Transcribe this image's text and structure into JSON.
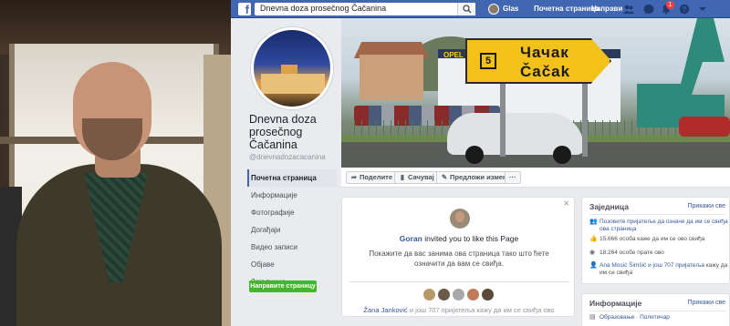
{
  "search": {
    "value": "Dnevna doza prosečnog Čačanina"
  },
  "topbar": {
    "user": "Glas",
    "home": "Почетна страница",
    "create": "Направи",
    "notifications_count": "1"
  },
  "page": {
    "name": "Dnevna doza prosečnog Čačanina",
    "handle": "@dnevnadozacacanina"
  },
  "nav": [
    {
      "label": "Почетна страница"
    },
    {
      "label": "Информације"
    },
    {
      "label": "Фотографије"
    },
    {
      "label": "Догађаји"
    },
    {
      "label": "Видео записи"
    },
    {
      "label": "Објаве"
    },
    {
      "label": "Заједница"
    }
  ],
  "create_page_label": "Направите страницу",
  "cover": {
    "sign_number": "5",
    "sign_line1": "Чачак",
    "sign_line2": "Čačak",
    "dealer": "OPEL"
  },
  "actions": {
    "share": "Поделите",
    "save": "Сачувај",
    "suggest": "Предложи измене",
    "more": "···"
  },
  "invite": {
    "inviter": "Goran",
    "text": "invited you to like this Page",
    "desc": "Покажите да вас занима ова страница тако што ћете означити да вам се свиђа.",
    "friends_name": "Žana Janković",
    "friends_rest": "и још 707 пријатеља кажу да им се свиђа ово"
  },
  "community": {
    "title": "Заједница",
    "see_all": "Прикажи све",
    "invite_friends": "Позовите пријатеље да означе да им се свиђа ова страница",
    "likes": "15.666 особа каже да им се ово свиђа",
    "follows": "18.264 особе прате ово",
    "friends_names": "Ana Mosić Šimšić и још 707 пријатеља",
    "friends_rest": "кажу да им се свиђа"
  },
  "information": {
    "title": "Информације",
    "see_all": "Прикажи све",
    "category": "Образовање · Политичар"
  },
  "colors": {
    "brand": "#4267b2",
    "link": "#385898",
    "green": "#42b72a",
    "badge": "#fa3e3e"
  }
}
